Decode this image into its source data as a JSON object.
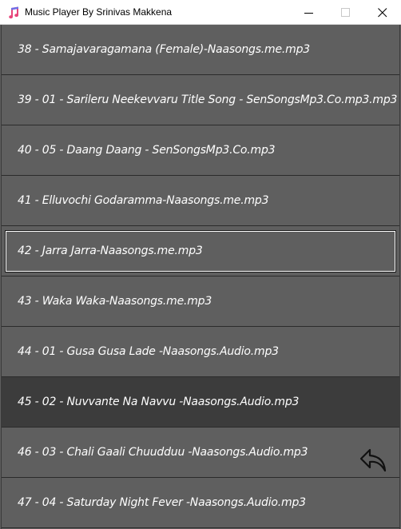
{
  "window": {
    "title": "Music Player By Srinivas Makkena",
    "app_icon": "music-note-icon",
    "controls": [
      "minimize-icon",
      "maximize-icon",
      "close-icon"
    ]
  },
  "songs": [
    "38 - Samajavaragamana (Female)-Naasongs.me.mp3",
    "39 - 01 - Sarileru Neekevvaru Title Song - SenSongsMp3.Co.mp3.mp3",
    "40 - 05 - Daang Daang - SenSongsMp3.Co.mp3",
    "41 - Elluvochi Godaramma-Naasongs.me.mp3",
    "42 - Jarra Jarra-Naasongs.me.mp3",
    "43 - Waka Waka-Naasongs.me.mp3",
    "44 - 01 - Gusa Gusa Lade -Naasongs.Audio.mp3",
    "45 - 02 - Nuvvante Na Navvu -Naasongs.Audio.mp3",
    "46 - 03 - Chali Gaali Chuudduu -Naasongs.Audio.mp3",
    "47 - 04 - Saturday Night Fever -Naasongs.Audio.mp3"
  ],
  "selected_song": "42 - Jarra Jarra-Naasongs.me.mp3",
  "highlighted_song": "45 - 02 - Nuvvante Na Navvu -Naasongs.Audio.mp3",
  "back_button": {
    "icon": "back-arrow-icon"
  },
  "colors": {
    "list_background": "#5f5f5f",
    "highlight_background": "#3c3c3c",
    "text": "#ffffff",
    "selection_border": "#ffffff"
  }
}
